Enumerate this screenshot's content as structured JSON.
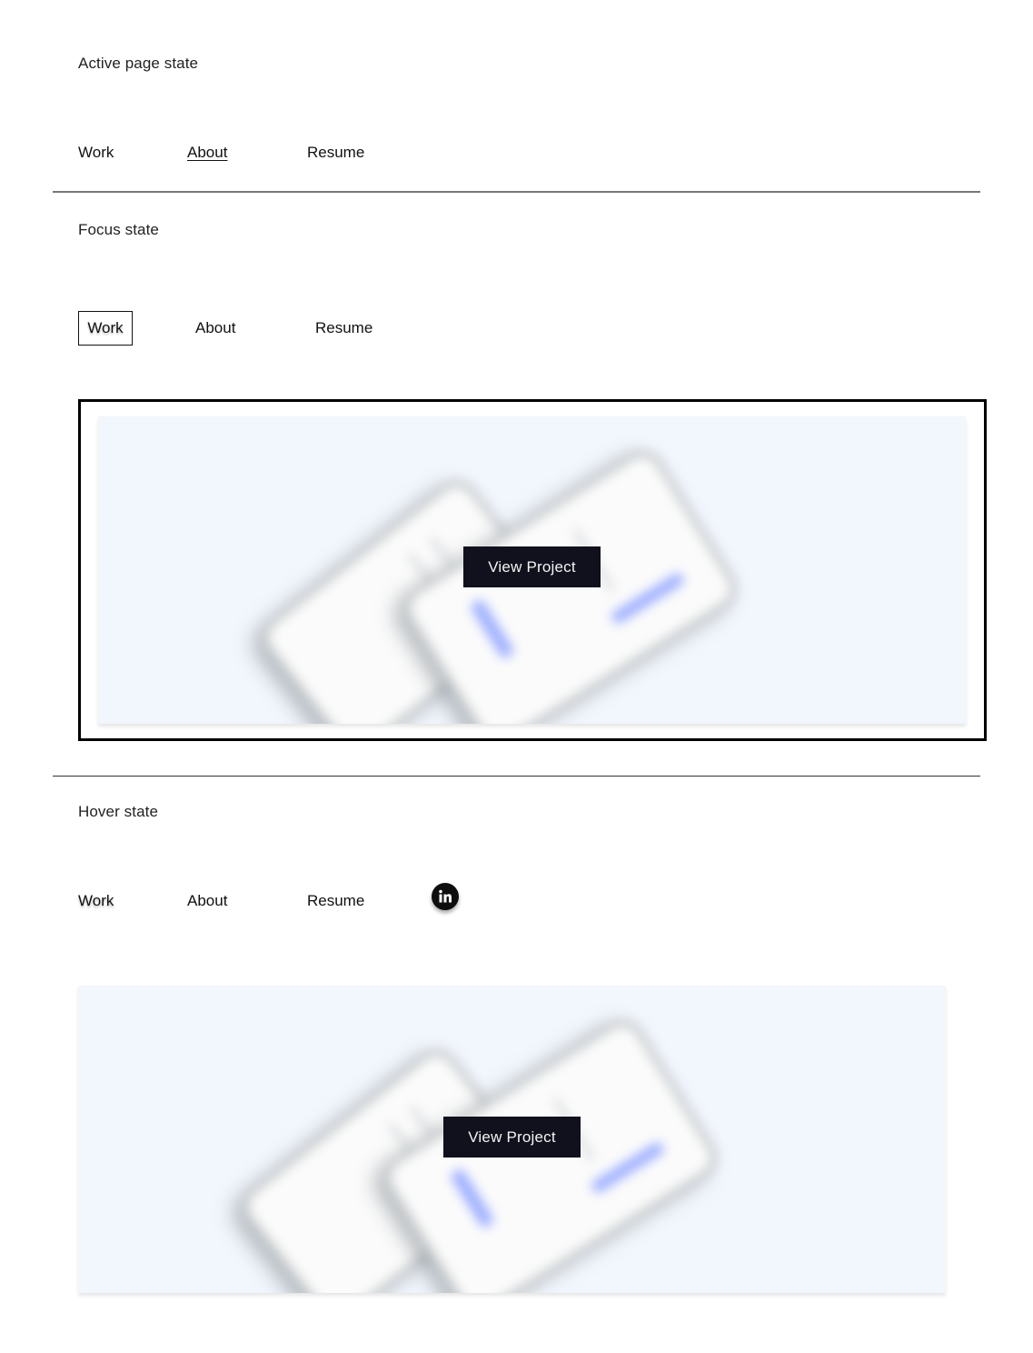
{
  "sections": {
    "active": {
      "label": "Active page state"
    },
    "focus": {
      "label": "Focus state"
    },
    "hover": {
      "label": "Hover state"
    }
  },
  "nav": {
    "work": "Work",
    "about": "About",
    "resume": "Resume"
  },
  "project": {
    "button_label": "View Project"
  },
  "icons": {
    "linkedin": "linkedin-icon",
    "linkedin_text": "in"
  },
  "colors": {
    "card_background": "#f2f6fd",
    "button_background": "#10111d",
    "accent_blue": "#9fb0ff"
  }
}
